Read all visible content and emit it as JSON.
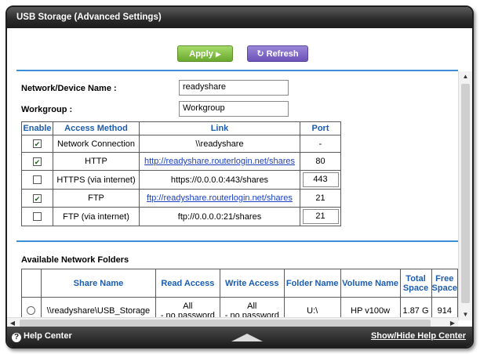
{
  "window": {
    "title": "USB Storage (Advanced Settings)"
  },
  "toolbar": {
    "apply_label": "Apply",
    "apply_glyph": "▶",
    "refresh_label": "Refresh",
    "refresh_glyph": "↻"
  },
  "form": {
    "network_device_name_label": "Network/Device Name :",
    "network_device_name_value": "readyshare",
    "workgroup_label": "Workgroup :",
    "workgroup_value": "Workgroup"
  },
  "access_table": {
    "headers": [
      "Enable",
      "Access Method",
      "Link",
      "Port"
    ],
    "rows": [
      {
        "enabled": "✔",
        "method": "Network Connection",
        "link": "\\\\readyshare",
        "link_is_url": false,
        "port": "-",
        "port_editable": false
      },
      {
        "enabled": "✔",
        "method": "HTTP",
        "link": "http://readyshare.routerlogin.net/shares",
        "link_is_url": true,
        "port": "80",
        "port_editable": false
      },
      {
        "enabled": "",
        "method": "HTTPS (via internet)",
        "link": "https://0.0.0.0:443/shares",
        "link_is_url": false,
        "port": "443",
        "port_editable": true
      },
      {
        "enabled": "✔",
        "method": "FTP",
        "link": "ftp://readyshare.routerlogin.net/shares",
        "link_is_url": true,
        "port": "21",
        "port_editable": false
      },
      {
        "enabled": "",
        "method": "FTP (via internet)",
        "link": "ftp://0.0.0.0:21/shares",
        "link_is_url": false,
        "port": "21",
        "port_editable": true
      }
    ]
  },
  "folders": {
    "section_title": "Available Network Folders",
    "headers": {
      "share_name": "Share Name",
      "read_access": "Read Access",
      "write_access": "Write Access",
      "folder_name": "Folder Name",
      "volume_name": "Volume Name",
      "total_space": "Total Space",
      "free_space": "Free Space"
    },
    "rows": [
      {
        "share_name": "\\\\readyshare\\USB_Storage",
        "read_access_1": "All",
        "read_access_2": "- no password",
        "write_access_1": "All",
        "write_access_2": "- no password",
        "folder_name": "U:\\",
        "volume_name": "HP v100w",
        "total_space": "1.87 G",
        "free_space": "914"
      }
    ]
  },
  "footer": {
    "help_center": "Help Center",
    "help_icon": "?",
    "show_hide": "Show/Hide Help Center"
  },
  "colors": {
    "accent_blue": "#3c8fd6",
    "header_text": "#1a5cb0",
    "apply_green": "#7ab83a",
    "refresh_purple": "#7a62c8"
  }
}
